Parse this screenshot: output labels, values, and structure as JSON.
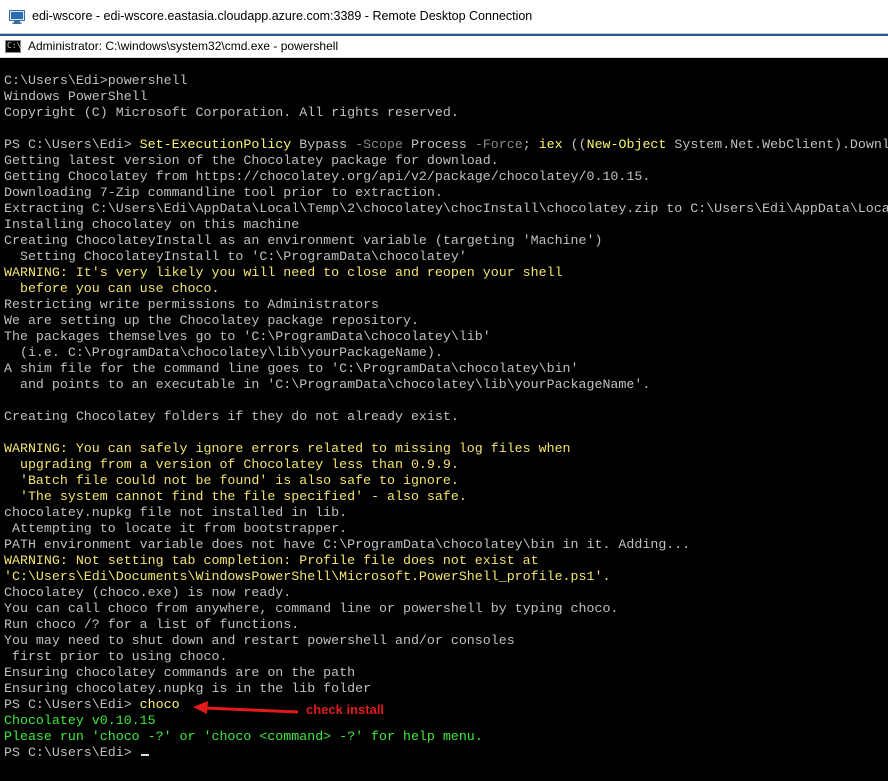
{
  "rdp_window": {
    "title": "edi-wscore - edi-wscore.eastasia.cloudapp.azure.com:3389 - Remote Desktop Connection",
    "icon": "remote-desktop-icon"
  },
  "console_window": {
    "title": "Administrator: C:\\windows\\system32\\cmd.exe - powershell",
    "icon": "cmd-icon",
    "icon_glyph": "C:\\"
  },
  "colors": {
    "default_text": "#c0c0c0",
    "warning_text": "#f2e46e",
    "success_text": "#3ce83c",
    "annotation": "#e11b1b"
  },
  "console": {
    "lines": [
      {
        "t": "C:\\Users\\Edi>powershell",
        "c": "w"
      },
      {
        "t": "Windows PowerShell",
        "c": "w"
      },
      {
        "t": "Copyright (C) Microsoft Corporation. All rights reserved.",
        "c": "w"
      },
      {
        "t": "",
        "c": "w"
      },
      {
        "t": "PS C:\\Users\\Edi> ",
        "c": "cmdline",
        "parts": [
          {
            "t": "Set-ExecutionPolicy",
            "c": "cmd"
          },
          {
            "t": " Bypass ",
            "c": "w"
          },
          {
            "t": "-Scope",
            "c": "arg"
          },
          {
            "t": " Process ",
            "c": "w"
          },
          {
            "t": "-Force",
            "c": "arg"
          },
          {
            "t": "; ",
            "c": "w"
          },
          {
            "t": "iex",
            "c": "cmd"
          },
          {
            "t": " ((",
            "c": "w"
          },
          {
            "t": "New-Object",
            "c": "cmd"
          },
          {
            "t": " System.Net.WebClient).Downl",
            "c": "w"
          }
        ]
      },
      {
        "t": "Getting latest version of the Chocolatey package for download.",
        "c": "w"
      },
      {
        "t": "Getting Chocolatey from https://chocolatey.org/api/v2/package/chocolatey/0.10.15.",
        "c": "w"
      },
      {
        "t": "Downloading 7-Zip commandline tool prior to extraction.",
        "c": "w"
      },
      {
        "t": "Extracting C:\\Users\\Edi\\AppData\\Local\\Temp\\2\\chocolatey\\chocInstall\\chocolatey.zip to C:\\Users\\Edi\\AppData\\Loca",
        "c": "w"
      },
      {
        "t": "Installing chocolatey on this machine",
        "c": "w"
      },
      {
        "t": "Creating ChocolateyInstall as an environment variable (targeting 'Machine')",
        "c": "w"
      },
      {
        "t": "  Setting ChocolateyInstall to 'C:\\ProgramData\\chocolatey'",
        "c": "w"
      },
      {
        "t": "WARNING: It's very likely you will need to close and reopen your shell",
        "c": "y"
      },
      {
        "t": "  before you can use choco.",
        "c": "y"
      },
      {
        "t": "Restricting write permissions to Administrators",
        "c": "w"
      },
      {
        "t": "We are setting up the Chocolatey package repository.",
        "c": "w"
      },
      {
        "t": "The packages themselves go to 'C:\\ProgramData\\chocolatey\\lib'",
        "c": "w"
      },
      {
        "t": "  (i.e. C:\\ProgramData\\chocolatey\\lib\\yourPackageName).",
        "c": "w"
      },
      {
        "t": "A shim file for the command line goes to 'C:\\ProgramData\\chocolatey\\bin'",
        "c": "w"
      },
      {
        "t": "  and points to an executable in 'C:\\ProgramData\\chocolatey\\lib\\yourPackageName'.",
        "c": "w"
      },
      {
        "t": "",
        "c": "w"
      },
      {
        "t": "Creating Chocolatey folders if they do not already exist.",
        "c": "w"
      },
      {
        "t": "",
        "c": "w"
      },
      {
        "t": "WARNING: You can safely ignore errors related to missing log files when",
        "c": "y"
      },
      {
        "t": "  upgrading from a version of Chocolatey less than 0.9.9.",
        "c": "y"
      },
      {
        "t": "  'Batch file could not be found' is also safe to ignore.",
        "c": "y"
      },
      {
        "t": "  'The system cannot find the file specified' - also safe.",
        "c": "y"
      },
      {
        "t": "chocolatey.nupkg file not installed in lib.",
        "c": "w"
      },
      {
        "t": " Attempting to locate it from bootstrapper.",
        "c": "w"
      },
      {
        "t": "PATH environment variable does not have C:\\ProgramData\\chocolatey\\bin in it. Adding...",
        "c": "w"
      },
      {
        "t": "WARNING: Not setting tab completion: Profile file does not exist at",
        "c": "y"
      },
      {
        "t": "'C:\\Users\\Edi\\Documents\\WindowsPowerShell\\Microsoft.PowerShell_profile.ps1'.",
        "c": "y"
      },
      {
        "t": "Chocolatey (choco.exe) is now ready.",
        "c": "w"
      },
      {
        "t": "You can call choco from anywhere, command line or powershell by typing choco.",
        "c": "w"
      },
      {
        "t": "Run choco /? for a list of functions.",
        "c": "w"
      },
      {
        "t": "You may need to shut down and restart powershell and/or consoles",
        "c": "w"
      },
      {
        "t": " first prior to using choco.",
        "c": "w"
      },
      {
        "t": "Ensuring chocolatey commands are on the path",
        "c": "w"
      },
      {
        "t": "Ensuring chocolatey.nupkg is in the lib folder",
        "c": "w"
      },
      {
        "t": "PS C:\\Users\\Edi> ",
        "c": "cmdline",
        "parts": [
          {
            "t": "choco",
            "c": "cmd"
          }
        ]
      },
      {
        "t": "Chocolatey v0.10.15",
        "c": "g"
      },
      {
        "t": "Please run 'choco -?' or 'choco <command> -?' for help menu.",
        "c": "g"
      },
      {
        "t": "PS C:\\Users\\Edi> ",
        "c": "prompt"
      }
    ]
  },
  "annotation": {
    "label": "check install"
  }
}
